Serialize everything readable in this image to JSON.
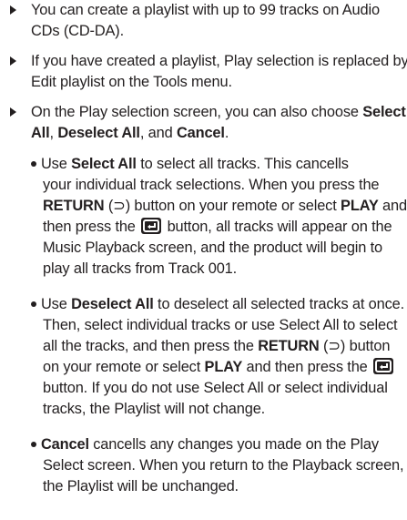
{
  "bullets": [
    {
      "lines": [
        "You can create a playlist with up to 99 tracks on Audio",
        "CDs (CD-DA)."
      ]
    },
    {
      "lines": [
        "If you have created a playlist, Play selection is replaced by",
        "Edit playlist on the Tools menu."
      ]
    },
    {
      "line1_pre": "On the Play selection screen, you can also choose ",
      "line1_bold": "Select",
      "line2_bold1": "All",
      "line2_sep1": ", ",
      "line2_bold2": "Deselect All",
      "line2_sep2": ", and ",
      "line2_bold3": "Cancel",
      "line2_end": "."
    }
  ],
  "sub_bullets": [
    {
      "l1_pre": "Use ",
      "l1_bold": "Select All",
      "l1_post": " to select all tracks. This cancells",
      "l2": "your individual track selections. When you press the",
      "l3_bold_return": "RETURN",
      "l3_return_symbol": "(⊃)",
      "l3_mid": " button on your remote or select ",
      "l3_bold_play": "PLAY",
      "l3_post": " and",
      "l4_pre": "then press the ",
      "l4_post": " button, all tracks will appear on the",
      "l5": "Music Playback screen, and the product will begin to",
      "l6": "play all tracks from Track 001."
    },
    {
      "l1_pre": "Use ",
      "l1_bold": "Deselect All",
      "l1_post": " to deselect all selected tracks at once.",
      "l2": "Then, select individual tracks or use Select All to select",
      "l3_pre": "all the tracks, and then press the ",
      "l3_bold_return": "RETURN",
      "l3_return_symbol": "(⊃)",
      "l3_post": " button",
      "l4_pre": "on your remote or select ",
      "l4_bold_play": "PLAY",
      "l4_post": " and then press the",
      "l5": "button. If you do not use Select All or select individual",
      "l6": "tracks, the Playlist will not change."
    },
    {
      "l1_bold": "Cancel",
      "l1_post": " cancells any changes you made on the Play",
      "l2": "Select screen. When you return to the Playback screen,",
      "l3": "the Playlist will be unchanged."
    }
  ],
  "icons": {
    "triangle": "triangle-bullet-icon",
    "dot": "round-bullet-icon",
    "return": "return-arrow-icon",
    "enter": "enter-button-icon"
  },
  "colors": {
    "text": "#231f20",
    "background": "#ffffff"
  }
}
